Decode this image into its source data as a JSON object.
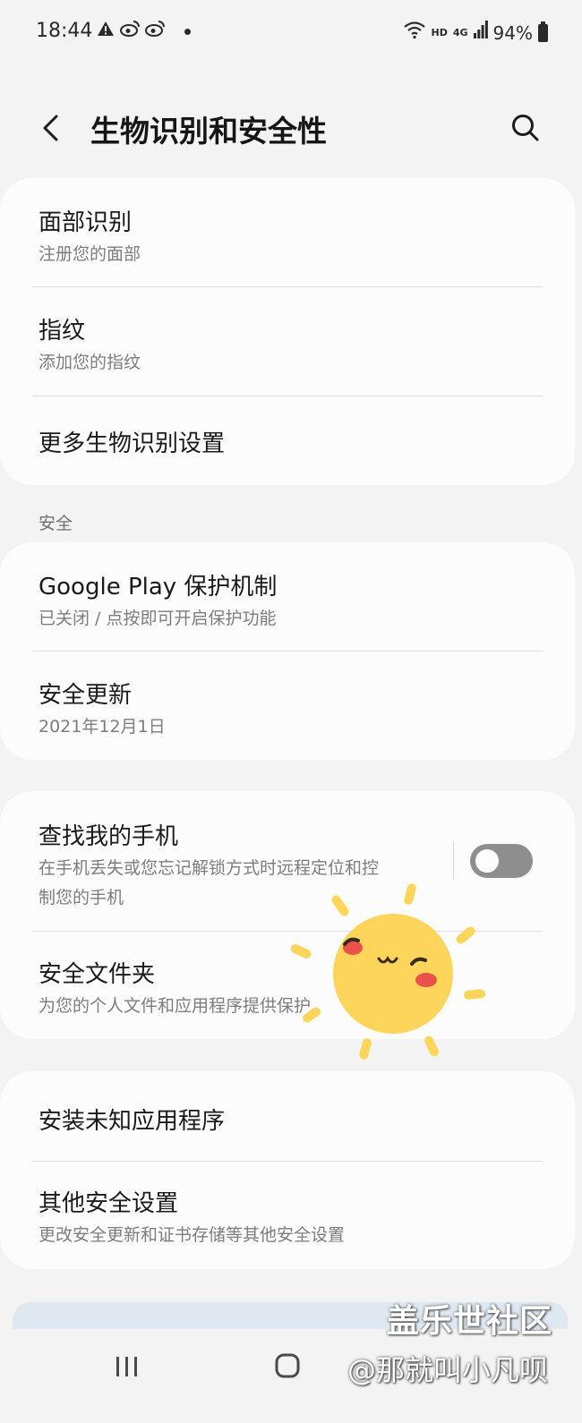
{
  "status_bar": {
    "time": "18:44",
    "network_label": "HD",
    "network_type": "4G",
    "battery": "94%"
  },
  "header": {
    "title": "生物识别和安全性",
    "back_icon": "chevron-left-icon",
    "search_icon": "search-icon"
  },
  "biometrics": {
    "items": [
      {
        "title": "面部识别",
        "subtitle": "注册您的面部"
      },
      {
        "title": "指纹",
        "subtitle": "添加您的指纹"
      },
      {
        "title": "更多生物识别设置"
      }
    ]
  },
  "security_section": {
    "label": "安全",
    "items": [
      {
        "title": "Google Play 保护机制",
        "subtitle": "已关闭 / 点按即可开启保护功能"
      },
      {
        "title": "安全更新",
        "subtitle": "2021年12月1日"
      }
    ]
  },
  "device_section": {
    "find_my_mobile": {
      "title": "查找我的手机",
      "subtitle_line1": "在手机丢失或您忘记解锁方式时远程定位和控",
      "subtitle_line2": "制您的手机",
      "enabled": false
    },
    "secure_folder": {
      "title": "安全文件夹",
      "subtitle": "为您的个人文件和应用程序提供保护"
    }
  },
  "other_section": {
    "items": [
      {
        "title": "安装未知应用程序"
      },
      {
        "title": "其他安全设置",
        "subtitle": "更改安全更新和证书存储等其他安全设置"
      }
    ]
  },
  "watermark": {
    "line1": "盖乐世社区",
    "line2": "@那就叫小凡呗"
  },
  "colors": {
    "background": "#f3f3f3",
    "card": "#fcfcfc",
    "toggle_off": "#8e8e8e",
    "sun": "#fdd55a"
  }
}
